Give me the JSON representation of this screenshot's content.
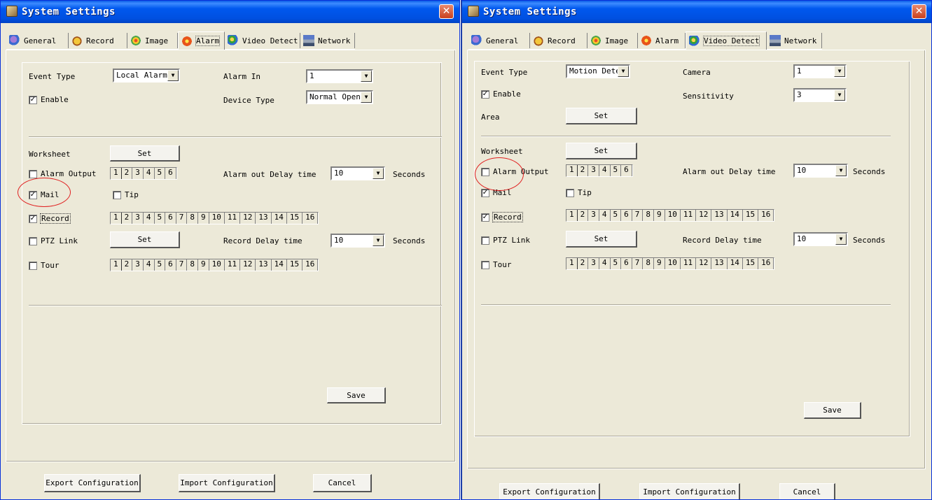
{
  "colors": {
    "title_bar": "#0054e3",
    "dialog_bg": "#ece9d8",
    "highlight_circle": "#e02020",
    "close_button": "#c9401e"
  },
  "left_window": {
    "title": "System Settings",
    "tabs": [
      {
        "label": "General",
        "icon": "general-icon"
      },
      {
        "label": "Record",
        "icon": "record-icon"
      },
      {
        "label": "Image",
        "icon": "image-icon"
      },
      {
        "label": "Alarm",
        "icon": "alarm-icon",
        "active": true
      },
      {
        "label": "Video Detect",
        "icon": "video-detect-icon"
      },
      {
        "label": "Network",
        "icon": "network-icon"
      }
    ],
    "event_type": {
      "label": "Event Type",
      "value": "Local Alarm"
    },
    "alarm_in": {
      "label": "Alarm In",
      "value": "1"
    },
    "enable": {
      "label": "Enable",
      "checked": true
    },
    "device_type": {
      "label": "Device Type",
      "value": "Normal Open"
    },
    "worksheet": {
      "label": "Worksheet",
      "button": "Set"
    },
    "alarm_output": {
      "label": "Alarm Output",
      "checked": false,
      "channels": [
        "1",
        "2",
        "3",
        "4",
        "5",
        "6"
      ]
    },
    "alarm_out_delay": {
      "label": "Alarm out Delay time",
      "value": "10",
      "unit": "Seconds"
    },
    "mail": {
      "label": "Mail",
      "checked": true
    },
    "tip": {
      "label": "Tip",
      "checked": false
    },
    "record": {
      "label": "Record",
      "checked": true,
      "channels": [
        "1",
        "2",
        "3",
        "4",
        "5",
        "6",
        "7",
        "8",
        "9",
        "10",
        "11",
        "12",
        "13",
        "14",
        "15",
        "16"
      ]
    },
    "ptz_link": {
      "label": "PTZ Link",
      "checked": false,
      "button": "Set"
    },
    "record_delay": {
      "label": "Record Delay time",
      "value": "10",
      "unit": "Seconds"
    },
    "tour": {
      "label": "Tour",
      "checked": false,
      "channels": [
        "1",
        "2",
        "3",
        "4",
        "5",
        "6",
        "7",
        "8",
        "9",
        "10",
        "11",
        "12",
        "13",
        "14",
        "15",
        "16"
      ]
    },
    "save": "Save",
    "export": "Export Configuration",
    "import": "Import Configuration",
    "cancel": "Cancel"
  },
  "right_window": {
    "title": "System Settings",
    "tabs": [
      {
        "label": "General",
        "icon": "general-icon"
      },
      {
        "label": "Record",
        "icon": "record-icon"
      },
      {
        "label": "Image",
        "icon": "image-icon"
      },
      {
        "label": "Alarm",
        "icon": "alarm-icon"
      },
      {
        "label": "Video Detect",
        "icon": "video-detect-icon",
        "active": true
      },
      {
        "label": "Network",
        "icon": "network-icon"
      }
    ],
    "event_type": {
      "label": "Event Type",
      "value": "Motion Dete"
    },
    "camera": {
      "label": "Camera",
      "value": "1"
    },
    "enable": {
      "label": "Enable",
      "checked": true
    },
    "sensitivity": {
      "label": "Sensitivity",
      "value": "3"
    },
    "area": {
      "label": "Area",
      "button": "Set"
    },
    "worksheet": {
      "label": "Worksheet",
      "button": "Set"
    },
    "alarm_output": {
      "label": "Alarm Output",
      "checked": false,
      "channels": [
        "1",
        "2",
        "3",
        "4",
        "5",
        "6"
      ]
    },
    "alarm_out_delay": {
      "label": "Alarm out Delay time",
      "value": "10",
      "unit": "Seconds"
    },
    "mail": {
      "label": "Mail",
      "checked": true
    },
    "tip": {
      "label": "Tip",
      "checked": false
    },
    "record": {
      "label": "Record",
      "checked": true,
      "channels": [
        "1",
        "2",
        "3",
        "4",
        "5",
        "6",
        "7",
        "8",
        "9",
        "10",
        "11",
        "12",
        "13",
        "14",
        "15",
        "16"
      ]
    },
    "ptz_link": {
      "label": "PTZ Link",
      "checked": false,
      "button": "Set"
    },
    "record_delay": {
      "label": "Record Delay time",
      "value": "10",
      "unit": "Seconds"
    },
    "tour": {
      "label": "Tour",
      "checked": false,
      "channels": [
        "1",
        "2",
        "3",
        "4",
        "5",
        "6",
        "7",
        "8",
        "9",
        "10",
        "11",
        "12",
        "13",
        "14",
        "15",
        "16"
      ]
    },
    "save": "Save",
    "export": "Export Configuration",
    "import": "Import Configuration",
    "cancel": "Cancel"
  }
}
